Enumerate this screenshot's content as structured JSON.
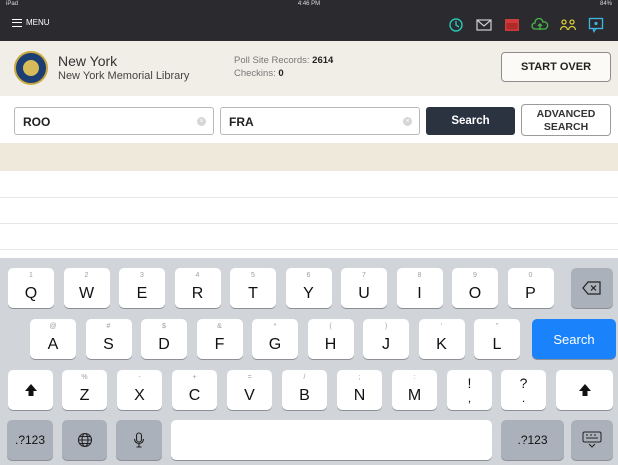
{
  "status_bar": {
    "left": "iPad",
    "time": "4:46 PM",
    "battery": "84%"
  },
  "header": {
    "menu_label": "MENU",
    "icons": [
      "history-icon",
      "mail-icon",
      "calendar-icon",
      "cloud-upload-icon",
      "people-icon",
      "chat-icon"
    ],
    "icon_colors": {
      "history": "#27c5b4",
      "mail": "#cfcfcf",
      "calendar": "#d03a3a",
      "cloud": "#48b649",
      "people": "#d8c63a",
      "chat": "#3db6e6"
    }
  },
  "location": {
    "state": "New York",
    "site": "New York Memorial Library",
    "poll_site_records_label": "Poll Site Records:",
    "poll_site_records_value": "2614",
    "checkins_label": "Checkins:",
    "checkins_value": "0",
    "start_over_label": "START OVER"
  },
  "search": {
    "last_name_value": "ROO",
    "first_name_value": "FRA",
    "search_label": "Search",
    "advanced_line1": "ADVANCED",
    "advanced_line2": "SEARCH"
  },
  "keyboard": {
    "row1": [
      {
        "key": "Q",
        "hint": "1"
      },
      {
        "key": "W",
        "hint": "2"
      },
      {
        "key": "E",
        "hint": "3"
      },
      {
        "key": "R",
        "hint": "4"
      },
      {
        "key": "T",
        "hint": "5"
      },
      {
        "key": "Y",
        "hint": "6"
      },
      {
        "key": "U",
        "hint": "7"
      },
      {
        "key": "I",
        "hint": "8"
      },
      {
        "key": "O",
        "hint": "9"
      },
      {
        "key": "P",
        "hint": "0"
      }
    ],
    "row2": [
      {
        "key": "A",
        "hint": "@"
      },
      {
        "key": "S",
        "hint": "#"
      },
      {
        "key": "D",
        "hint": "$"
      },
      {
        "key": "F",
        "hint": "&"
      },
      {
        "key": "G",
        "hint": "*"
      },
      {
        "key": "H",
        "hint": "("
      },
      {
        "key": "J",
        "hint": ")"
      },
      {
        "key": "K",
        "hint": "'"
      },
      {
        "key": "L",
        "hint": "\""
      }
    ],
    "row3": [
      {
        "key": "Z",
        "hint": "%"
      },
      {
        "key": "X",
        "hint": "-"
      },
      {
        "key": "C",
        "hint": "+"
      },
      {
        "key": "V",
        "hint": "="
      },
      {
        "key": "B",
        "hint": "/"
      },
      {
        "key": "N",
        "hint": ";"
      },
      {
        "key": "M",
        "hint": ":"
      }
    ],
    "punct1": {
      "top": "!",
      "bottom": ","
    },
    "punct2": {
      "top": "?",
      "bottom": "."
    },
    "search_key": "Search",
    "numbers_key": ".?123"
  }
}
